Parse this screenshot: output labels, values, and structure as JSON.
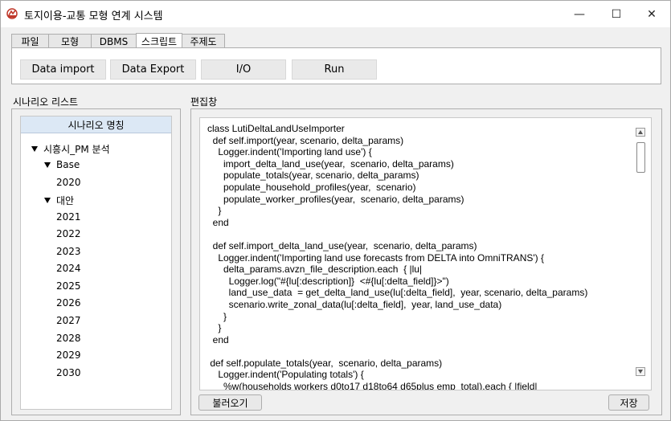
{
  "window": {
    "title": "토지이용-교통 모형 연계 시스템",
    "min_glyph": "—",
    "max_glyph": "☐",
    "close_glyph": "✕"
  },
  "tabs": [
    {
      "label": "파일",
      "active": false
    },
    {
      "label": "모형",
      "active": false
    },
    {
      "label": "DBMS",
      "active": false
    },
    {
      "label": "스크립트",
      "active": true
    },
    {
      "label": "주제도",
      "active": false
    }
  ],
  "toolbar": {
    "data_import": "Data import",
    "data_export": "Data Export",
    "io": "I/O",
    "run": "Run"
  },
  "scenario_list": {
    "group_label": "시나리오 리스트",
    "header": "시나리오 명칭",
    "root": "시흥시_PM 분석",
    "base": "Base",
    "base_years": [
      "2020"
    ],
    "alt": "대안",
    "alt_years": [
      "2021",
      "2022",
      "2023",
      "2024",
      "2025",
      "2026",
      "2027",
      "2028",
      "2029",
      "2030"
    ]
  },
  "editor": {
    "group_label": "편집창",
    "code": "class LutiDeltaLandUseImporter\n  def self.import(year, scenario, delta_params)\n    Logger.indent('Importing land use') {\n      import_delta_land_use(year,  scenario, delta_params)\n      populate_totals(year, scenario, delta_params)\n      populate_household_profiles(year,  scenario)\n      populate_worker_profiles(year,  scenario, delta_params)\n    }\n  end\n\n  def self.import_delta_land_use(year,  scenario, delta_params)\n    Logger.indent('Importing land use forecasts from DELTA into OmniTRANS') {\n      delta_params.avzn_file_description.each  { |lu|\n        Logger.log(\"#{lu[:description]}  <#{lu[:delta_field]}>\")\n        land_use_data  = get_delta_land_use(lu[:delta_field],  year, scenario, delta_params)\n        scenario.write_zonal_data(lu[:delta_field],  year, land_use_data)\n      }\n    }\n  end\n\n def self.populate_totals(year,  scenario, delta_params)\n    Logger.indent('Populating totals') {\n      %w(households workers d0to17 d18to64 d65plus emp_total).each { |field|",
    "load_button": "불러오기",
    "save_button": "저장"
  },
  "colors": {
    "window_bg": "#f0f0f0",
    "list_header_bg": "#dce8f5",
    "app_icon": "#c0392b"
  },
  "icons": [
    "app-icon",
    "minimize-icon",
    "maximize-icon",
    "close-icon",
    "expand-triangle-icon",
    "scroll-up-icon",
    "scroll-down-icon"
  ]
}
